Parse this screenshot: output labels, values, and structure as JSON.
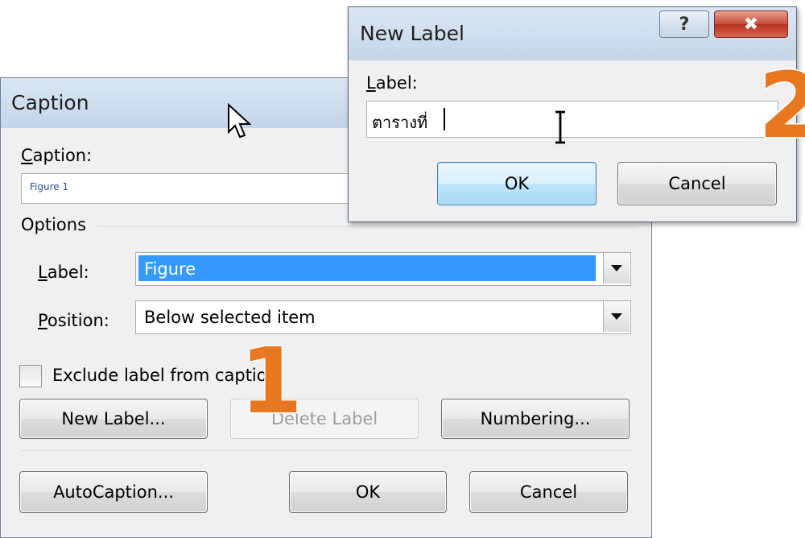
{
  "caption_dialog": {
    "title": "Caption",
    "caption_label": "Caption:",
    "caption_value": "Figure 1",
    "options_label": "Options",
    "label_label": "Label:",
    "label_value": "Figure",
    "position_label": "Position:",
    "position_value": "Below selected item",
    "exclude_label": "Exclude label from caption",
    "exclude_checked": false,
    "buttons": {
      "new_label": "New Label...",
      "delete_label": "Delete Label",
      "numbering": "Numbering...",
      "autocaption": "AutoCaption...",
      "ok": "OK",
      "cancel": "Cancel"
    }
  },
  "new_label_dialog": {
    "title": "New Label",
    "help_glyph": "?",
    "close_glyph": "✖",
    "label_label": "Label:",
    "label_value": "ตารางที่ ",
    "buttons": {
      "ok": "OK",
      "cancel": "Cancel"
    }
  },
  "callouts": {
    "step1": "1",
    "step2": "2"
  },
  "colors": {
    "callout": "#e87722",
    "selection": "#3399ff",
    "close_button": "#c64b38"
  },
  "icons": {
    "cursor_arrow": "arrow-cursor-icon",
    "cursor_text": "ibeam-cursor-icon",
    "dropdown": "chevron-down-icon"
  }
}
